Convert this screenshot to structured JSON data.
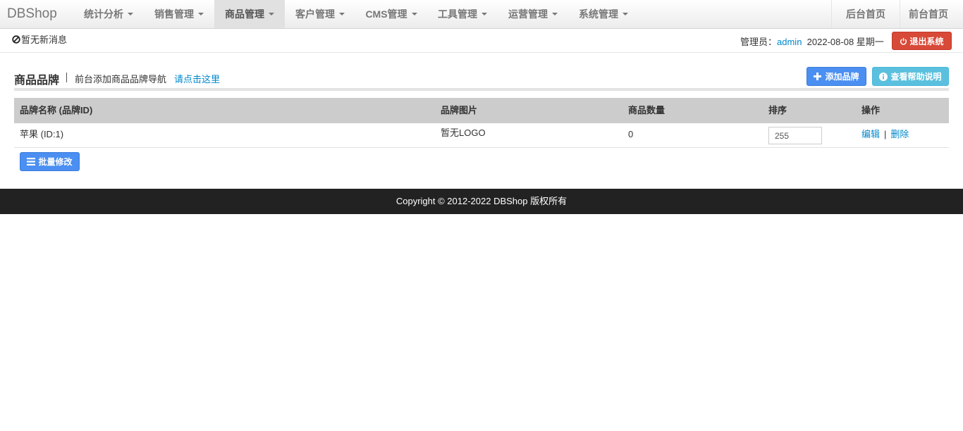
{
  "navbar": {
    "brand": "DBShop",
    "menus": [
      {
        "label": "统计分析"
      },
      {
        "label": "销售管理"
      },
      {
        "label": "商品管理"
      },
      {
        "label": "客户管理"
      },
      {
        "label": "CMS管理"
      },
      {
        "label": "工具管理"
      },
      {
        "label": "运营管理"
      },
      {
        "label": "系统管理"
      }
    ],
    "active_menu": "商品管理",
    "right_links": [
      {
        "label": "后台首页"
      },
      {
        "label": "前台首页"
      }
    ]
  },
  "message_bar": {
    "message": "暂无新消息",
    "admin_label": "管理员：",
    "admin_name": "admin",
    "date": "2022-08-08 星期一",
    "logout_label": "退出系统"
  },
  "page": {
    "title": "商品品牌",
    "description": "前台添加商品品牌导航",
    "description_link": "请点击这里",
    "add_button": "添加品牌",
    "help_button": "查看帮助说明"
  },
  "table": {
    "columns": [
      "品牌名称 (品牌ID)",
      "品牌图片",
      "商品数量",
      "排序",
      "操作"
    ],
    "rows": [
      {
        "name": "苹果 (ID:1)",
        "image": "暂无LOGO",
        "count": "0",
        "sort": "255",
        "edit": "编辑",
        "delete": "删除"
      }
    ]
  },
  "batch_button": "批量修改",
  "footer": "Copyright © 2012-2022 DBShop 版权所有",
  "colors": {
    "link": "#0088cc",
    "primary_button": "#4a8ff1",
    "info_button": "#5bc0de",
    "danger_button": "#d84a38",
    "footer_bg": "#222222"
  }
}
